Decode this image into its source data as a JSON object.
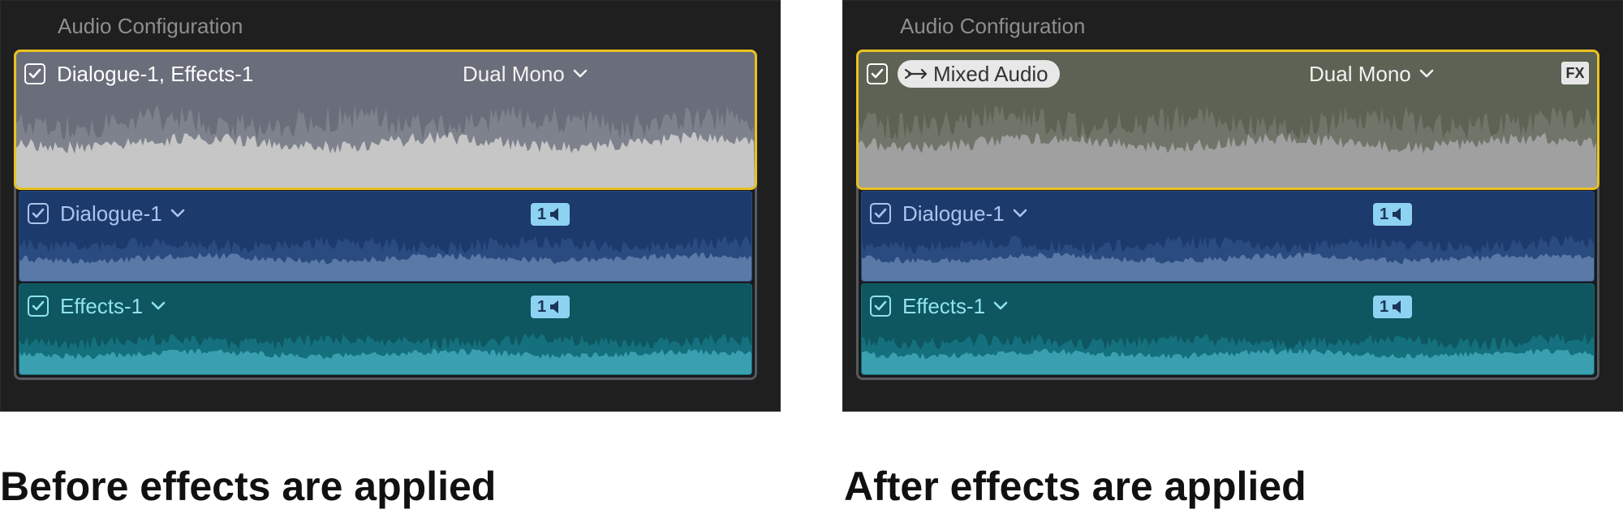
{
  "before": {
    "panel_title": "Audio Configuration",
    "main_lane": {
      "label": "Dialogue-1, Effects-1",
      "mode": "Dual Mono",
      "checked": true
    },
    "dialogue_lane": {
      "label": "Dialogue-1",
      "channel": "1",
      "checked": true
    },
    "effects_lane": {
      "label": "Effects-1",
      "channel": "1",
      "checked": true
    },
    "caption": "Before effects are applied"
  },
  "after": {
    "panel_title": "Audio Configuration",
    "main_lane": {
      "label": "Mixed Audio",
      "mode": "Dual Mono",
      "fx": "FX",
      "checked": true
    },
    "dialogue_lane": {
      "label": "Dialogue-1",
      "channel": "1",
      "checked": true
    },
    "effects_lane": {
      "label": "Effects-1",
      "channel": "1",
      "checked": true
    },
    "caption": "After effects are applied"
  },
  "colors": {
    "panel_bg": "#1f1f1f",
    "selection_border": "#e9c220",
    "main_lane_before": "#6a6e7a",
    "main_wave_before": "#c6c6c6",
    "main_lane_after": "#5d6354",
    "main_wave_after": "#a0a0a0",
    "dialogue_lane": "#1c3a6b",
    "dialogue_wave": "#5a79a7",
    "dialogue_text": "#a9c4ee",
    "effects_lane": "#0e5660",
    "effects_wave": "#3aa0b0",
    "effects_text": "#8fe3ef",
    "channel_badge": "#8ed2f2"
  },
  "icons": [
    "checkbox-icon",
    "chevron-down-icon",
    "speaker-icon",
    "mixed-audio-arrow-icon",
    "fx-icon"
  ]
}
